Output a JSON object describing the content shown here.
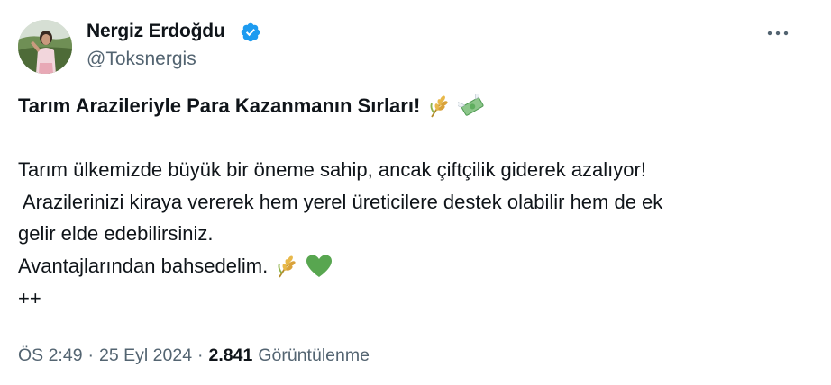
{
  "author": {
    "display_name": "Nergiz Erdoğdu",
    "handle": "@Toksnergis",
    "verified": true,
    "verified_color": "#1d9bf0"
  },
  "more_icon": "more-horizontal-icon",
  "tweet": {
    "title": "Tarım Arazileriyle Para Kazanmanın Sırları!",
    "title_emojis": [
      "wheat-emoji",
      "money-with-wings-emoji"
    ],
    "lines": [
      "Tarım ülkemizde büyük bir öneme sahip, ancak çiftçilik giderek azalıyor!",
      " Arazilerinizi kiraya vererek hem yerel üreticilere destek olabilir hem de ek",
      "gelir elde edebilirsiniz.",
      "Avantajlarından bahsedelim."
    ],
    "line4_emojis": [
      "wheat-emoji",
      "green-heart-emoji"
    ],
    "last_line": "++"
  },
  "meta": {
    "time": "ÖS 2:49",
    "separator": "·",
    "date": "25 Eyl 2024",
    "views_count": "2.841",
    "views_label": "Görüntülenme"
  },
  "colors": {
    "text": "#0f1419",
    "secondary": "#536471",
    "verified": "#1d9bf0",
    "heart": "#58a650"
  }
}
